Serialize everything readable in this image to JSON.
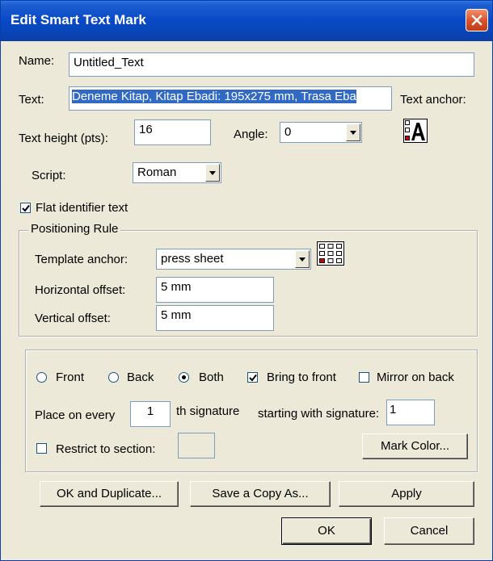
{
  "window": {
    "title": "Edit Smart Text Mark"
  },
  "name": {
    "label": "Name:",
    "value": "Untitled_Text"
  },
  "text": {
    "label": "Text:",
    "value": "Deneme Kitap,  Kitap Ebadi: 195x275 mm, Trasa Eba"
  },
  "text_anchor_label": "Text anchor:",
  "text_height": {
    "label": "Text height (pts):",
    "value": "16"
  },
  "angle": {
    "label": "Angle:",
    "value": "0"
  },
  "script": {
    "label": "Script:",
    "value": "Roman"
  },
  "flat_identifier": {
    "label": "Flat identifier text",
    "checked": true
  },
  "positioning": {
    "title": "Positioning Rule",
    "template_anchor_label": "Template anchor:",
    "template_anchor_value": "press sheet",
    "horizontal_offset_label": "Horizontal offset:",
    "horizontal_offset_value": "5 mm",
    "vertical_offset_label": "Vertical offset:",
    "vertical_offset_value": "5 mm"
  },
  "placement": {
    "front_label": "Front",
    "back_label": "Back",
    "both_label": "Both",
    "selected": "Both",
    "bring_to_front_label": "Bring to front",
    "bring_to_front_checked": true,
    "mirror_on_back_label": "Mirror on back",
    "mirror_on_back_checked": false,
    "place_every_label": "Place on every",
    "place_every_value": "1",
    "th_signature_label": "th signature",
    "starting_with_label": "starting with signature:",
    "starting_with_value": "1",
    "restrict_label": "Restrict to section:",
    "restrict_checked": false,
    "restrict_value": "",
    "mark_color_label": "Mark Color..."
  },
  "buttons": {
    "ok_duplicate": "OK and Duplicate...",
    "save_copy": "Save a Copy As...",
    "apply": "Apply",
    "ok": "OK",
    "cancel": "Cancel"
  },
  "colors": {
    "title_bar": "#0a4ac8",
    "selection": "#316ac5",
    "close_button": "#d8502a",
    "anchor_marker": "#cc0000"
  },
  "icons": {
    "close": "close-icon",
    "text_anchor": "text-anchor-icon",
    "template_anchor": "template-anchor-grid-icon",
    "check": "checkmark-icon"
  }
}
